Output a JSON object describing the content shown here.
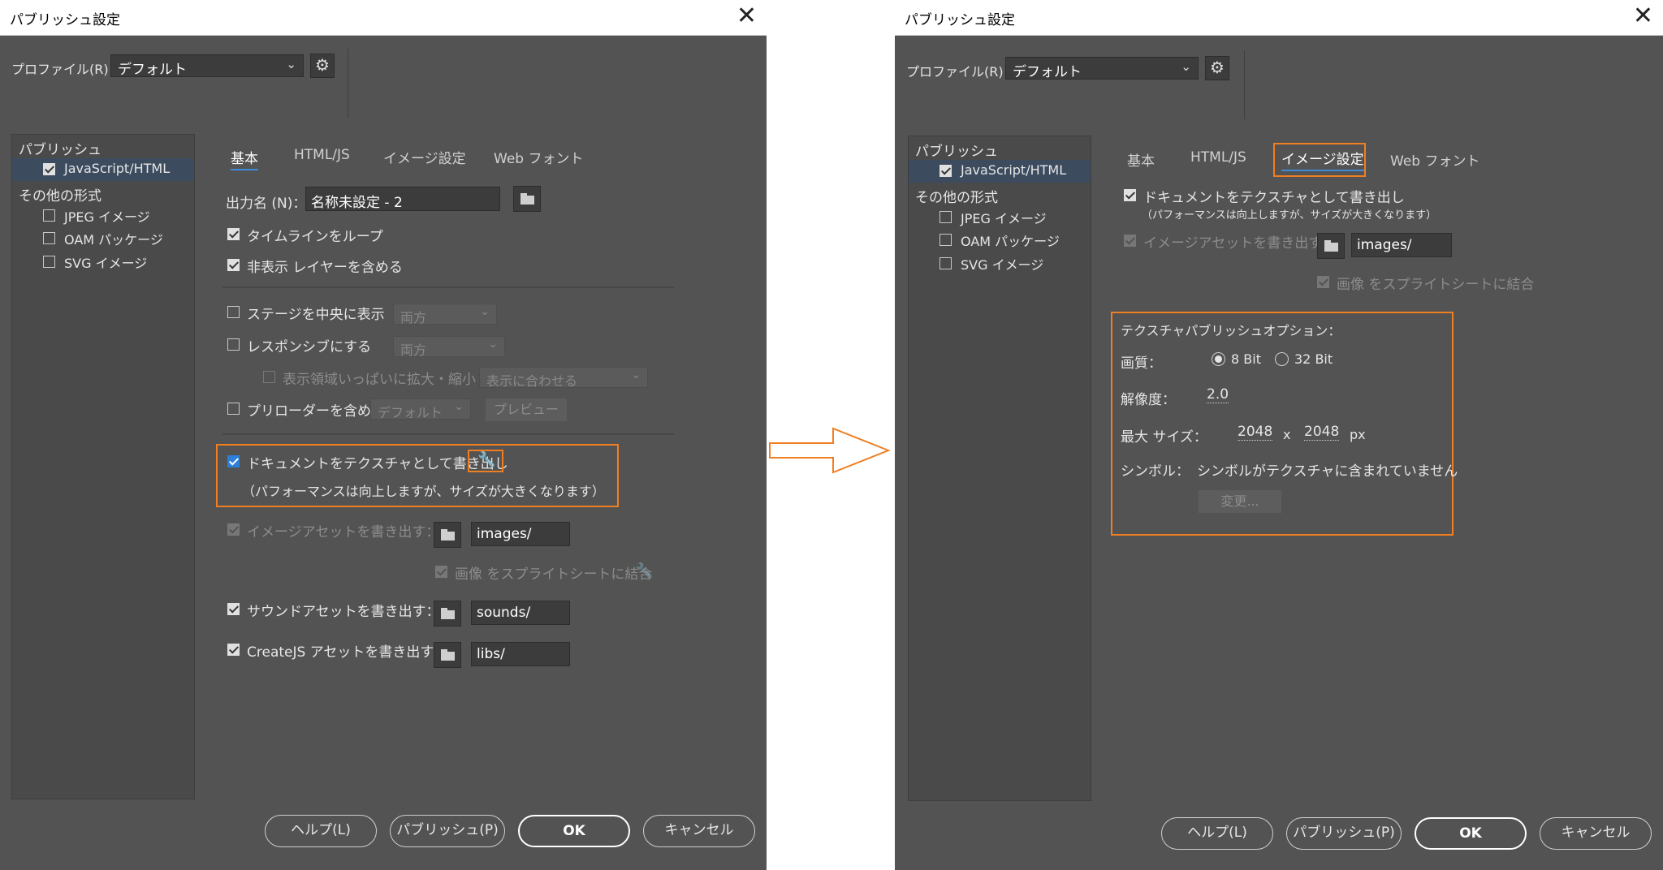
{
  "dialog_title": "パブリッシュ設定",
  "profile": {
    "label": "プロファイル(R)：",
    "value": "デフォルト"
  },
  "tree": {
    "publish_header": "パブリッシュ",
    "js_html": "JavaScript/HTML",
    "other_header": "その他の形式",
    "jpeg": "JPEG イメージ",
    "oam": "OAM パッケージ",
    "svg": "SVG イメージ"
  },
  "tabs": {
    "basic": "基本",
    "htmljs": "HTML/JS",
    "image": "イメージ設定",
    "webfont": "Web フォント"
  },
  "left": {
    "output_label": "出力名 (N)：",
    "output_value": "名称未設定 - 2",
    "loop_timeline": "タイムラインをループ",
    "include_hidden": "非表示 レイヤーを含める",
    "center_stage": "ステージを中央に表示",
    "center_option": "両方",
    "responsive": "レスポンシブにする",
    "responsive_option": "両方",
    "scale_fill": "表示領域いっぱいに拡大・縮小",
    "scale_option": "表示に合わせる",
    "preloader": "プリローダーを含める",
    "preloader_option": "デフォルト",
    "preview": "プレビュー",
    "texture_export": "ドキュメントをテクスチャとして書き出し",
    "texture_note": "（パフォーマンスは向上しますが、サイズが大きくなります）",
    "image_assets": "イメージアセットを書き出す：",
    "image_path": "images/",
    "sprite_sheet": "画像 をスプライトシートに結合",
    "sound_assets": "サウンドアセットを書き出す：",
    "sound_path": "sounds/",
    "createjs_assets": "CreateJS アセットを書き出す：",
    "createjs_path": "libs/"
  },
  "right": {
    "texture_export": "ドキュメントをテクスチャとして書き出し",
    "texture_note": "（パフォーマンスは向上しますが、サイズが大きくなります）",
    "image_assets": "イメージアセットを書き出す：",
    "image_path": "images/",
    "sprite_sheet": "画像 をスプライトシートに結合",
    "options_header": "テクスチャパブリッシュオプション：",
    "quality_label": "画質：",
    "bit8": "8 Bit",
    "bit32": "32 Bit",
    "resolution_label": "解像度：",
    "resolution_value": "2.0",
    "maxsize_label": "最大 サイズ：",
    "max_w": "2048",
    "x": "x",
    "max_h": "2048",
    "px": "px",
    "symbol_label": "シンボル：",
    "symbol_value": "シンボルがテクスチャに含まれていません",
    "change": "変更..."
  },
  "buttons": {
    "help": "ヘルプ(L)",
    "publish": "パブリッシュ(P)",
    "ok": "OK",
    "cancel": "キャンセル"
  },
  "colors": {
    "accent": "#f07f22",
    "selection": "#3c4b5e",
    "dialog_bg": "#535353"
  }
}
